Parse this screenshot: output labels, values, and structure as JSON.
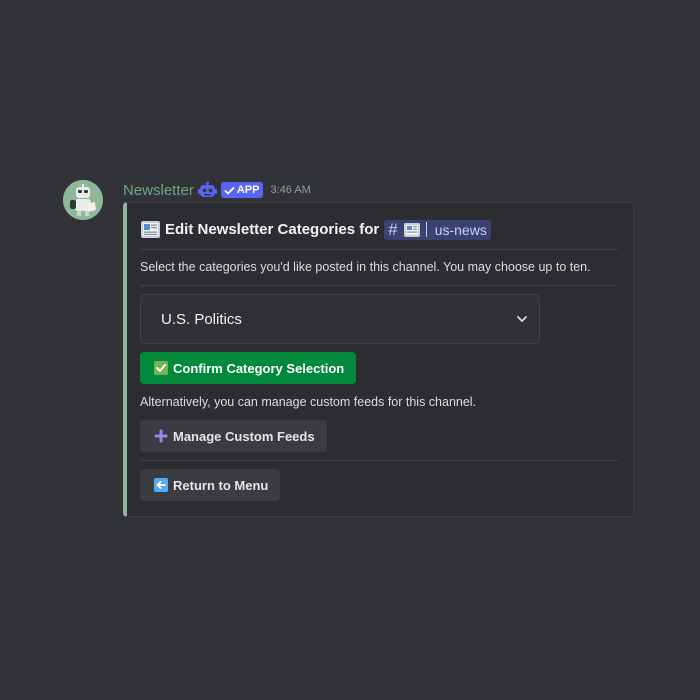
{
  "message": {
    "author": "Newsletter",
    "badge": "APP",
    "timestamp": "3:46 AM"
  },
  "embed": {
    "title_prefix": "Edit Newsletter Categories for",
    "channel": {
      "hash": "#",
      "name": "us-news"
    },
    "description": "Select the categories you'd like posted in this channel. You may choose up to ten.",
    "select": {
      "selected_value": "U.S. Politics"
    },
    "confirm_button": "Confirm Category Selection",
    "alt_text": "Alternatively, you can manage custom feeds for this channel.",
    "manage_button": "Manage Custom Feeds",
    "return_button": "Return to Menu"
  },
  "colors": {
    "background": "#313338",
    "embed_bg": "#2b2d31",
    "embed_accent": "#8fb79a",
    "username": "#6fa77d",
    "app_badge": "#5865f2",
    "success_button": "#03893c",
    "secondary_button": "#3a3c41",
    "mention_bg": "#3c4270"
  },
  "icons": {
    "bot": "robot-icon",
    "verified": "check-icon",
    "title": "newspaper-icon",
    "channel_emoji": "newspaper-icon",
    "select": "chevron-down-icon",
    "confirm": "check-box-icon",
    "manage": "plus-icon",
    "return": "left-arrow-icon"
  }
}
